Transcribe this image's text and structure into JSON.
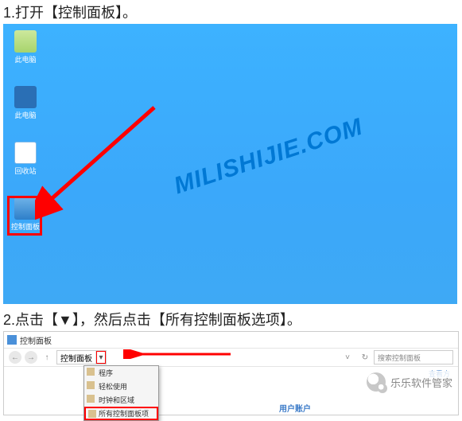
{
  "step1": {
    "text": "1.打开【控制面板】。"
  },
  "desktop": {
    "icons": [
      {
        "label": "此电脑"
      },
      {
        "label": "此电脑"
      },
      {
        "label": "回收站"
      },
      {
        "label": "控制面板"
      }
    ],
    "watermark": "MILISHIJIE.COM"
  },
  "step2": {
    "text": "2.点击【▼】，然后点击【所有控制面板选项】。"
  },
  "explorer": {
    "title": "控制面板",
    "address_seg": "控制面板",
    "dropdown_items": [
      "程序",
      "轻松使用",
      "时钟和区域",
      "所有控制面板项"
    ],
    "search_placeholder": "搜索控制面板",
    "view_all": "查看方",
    "content_label": "用户账户"
  },
  "brand": {
    "text": "乐乐软件管家"
  }
}
